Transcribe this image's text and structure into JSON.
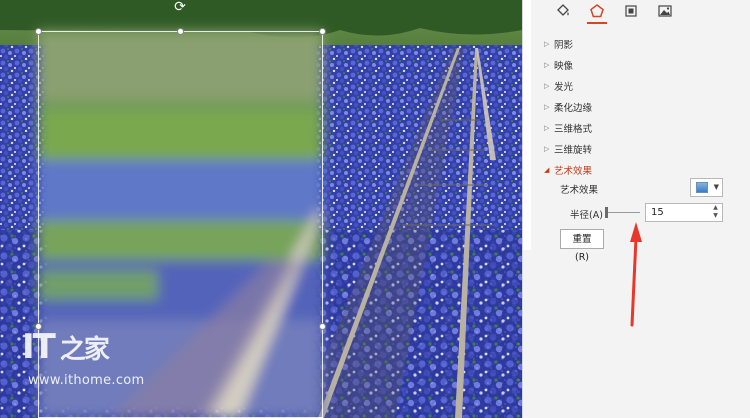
{
  "watermark": {
    "logo_text": "IT",
    "logo_glyph": "之家",
    "url": "www.ithome.com"
  },
  "format_pane": {
    "tabs": [
      {
        "icon": "fill-bucket-icon",
        "active": false
      },
      {
        "icon": "pentagon-effects-icon",
        "active": true
      },
      {
        "icon": "size-layout-icon",
        "active": false
      },
      {
        "icon": "picture-icon",
        "active": false
      }
    ],
    "sections": [
      {
        "label": "阴影",
        "expanded": false
      },
      {
        "label": "映像",
        "expanded": false
      },
      {
        "label": "发光",
        "expanded": false
      },
      {
        "label": "柔化边缘",
        "expanded": false
      },
      {
        "label": "三维格式",
        "expanded": false
      },
      {
        "label": "三维旋转",
        "expanded": false
      },
      {
        "label": "艺术效果",
        "expanded": true
      }
    ],
    "artistic": {
      "effect_label": "艺术效果",
      "radius_label": "半径(A)",
      "radius_value": "15",
      "reset_label": "重置(R)"
    }
  },
  "colors": {
    "accent": "#d24726",
    "expanded_section": "#c43e1c",
    "annotation_arrow": "#e8382c"
  }
}
